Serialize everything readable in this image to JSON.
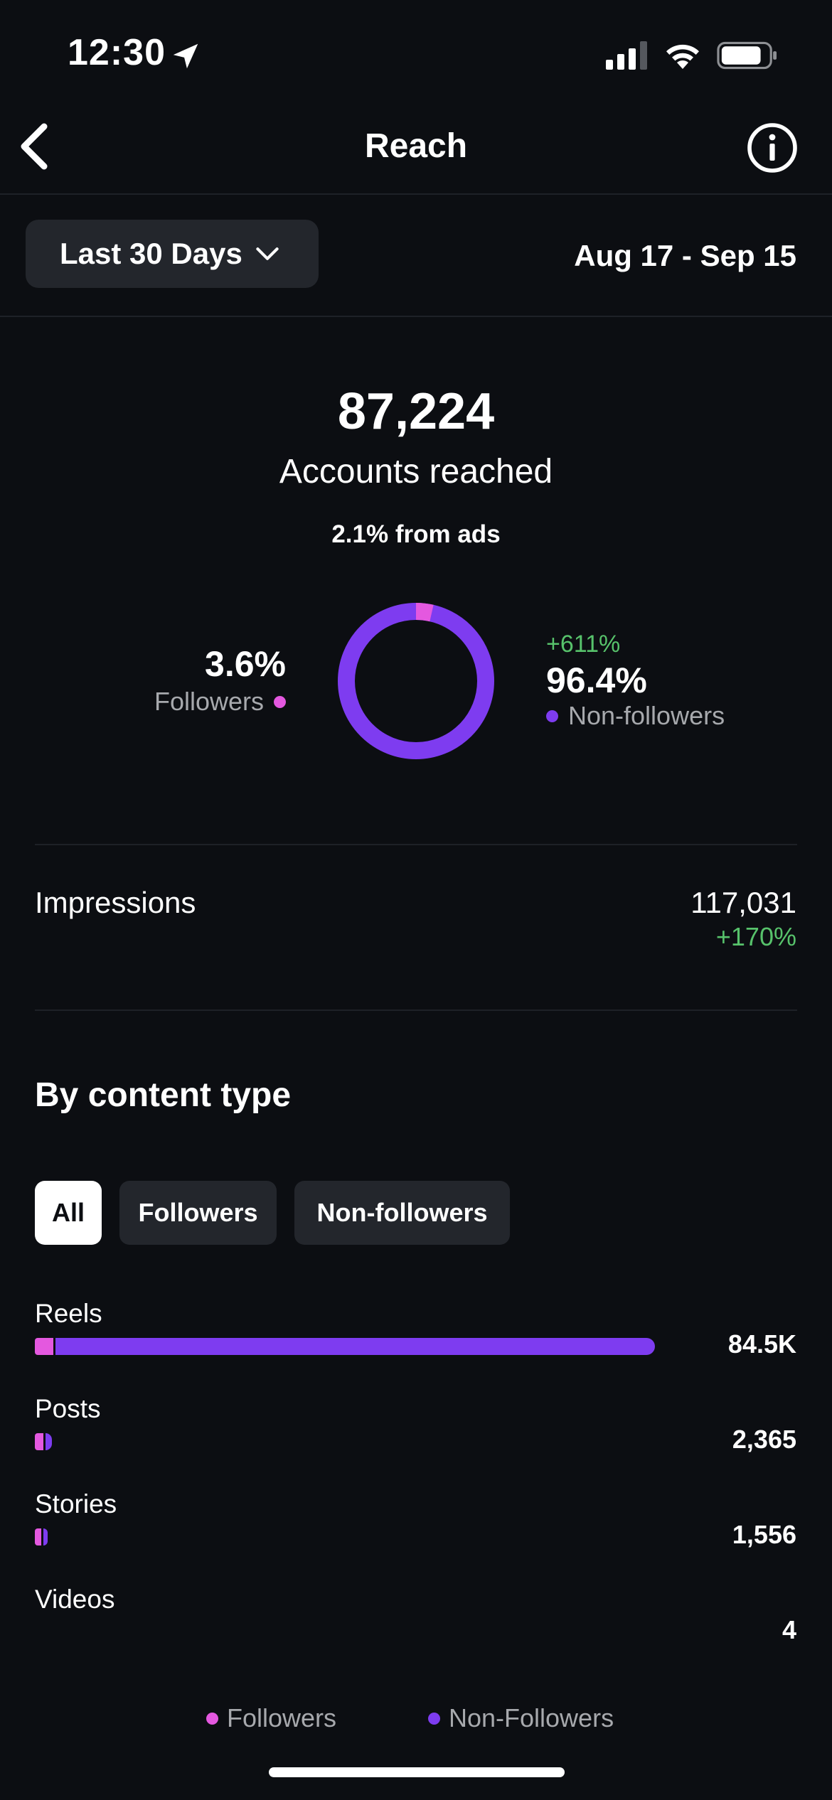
{
  "status_bar": {
    "time": "12:30"
  },
  "header": {
    "title": "Reach"
  },
  "date_filter": {
    "period_label": "Last 30 Days",
    "date_range": "Aug 17 - Sep 15"
  },
  "summary": {
    "accounts_reached": "87,224",
    "accounts_reached_label": "Accounts reached",
    "ads_share": "2.1% from ads",
    "followers_pct": "3.6%",
    "followers_label": "Followers",
    "nonfollowers_change": "+611%",
    "nonfollowers_pct": "96.4%",
    "nonfollowers_label": "Non-followers",
    "donut": {
      "followers_fraction": 0.036,
      "nonfollowers_fraction": 0.964
    }
  },
  "impressions": {
    "label": "Impressions",
    "value": "117,031",
    "change": "+170%"
  },
  "content_type": {
    "title": "By content type",
    "chips": [
      "All",
      "Followers",
      "Non-followers"
    ],
    "selected_chip": "All",
    "rows": [
      {
        "label": "Reels",
        "value": "84.5K",
        "total_fraction": 1.0,
        "follower_fraction": 0.03
      },
      {
        "label": "Posts",
        "value": "2,365",
        "total_fraction": 0.028,
        "follower_fraction": 0.5
      },
      {
        "label": "Stories",
        "value": "1,556",
        "total_fraction": 0.018,
        "follower_fraction": 0.6
      },
      {
        "label": "Videos",
        "value": "4",
        "total_fraction": 0.0,
        "follower_fraction": 0.0
      }
    ],
    "legend": {
      "followers": "Followers",
      "nonfollowers": "Non-Followers"
    }
  },
  "colors": {
    "followers": "#e458df",
    "nonfollowers": "#7e3cf0",
    "positive": "#57c26b",
    "background": "#0c0e12"
  }
}
